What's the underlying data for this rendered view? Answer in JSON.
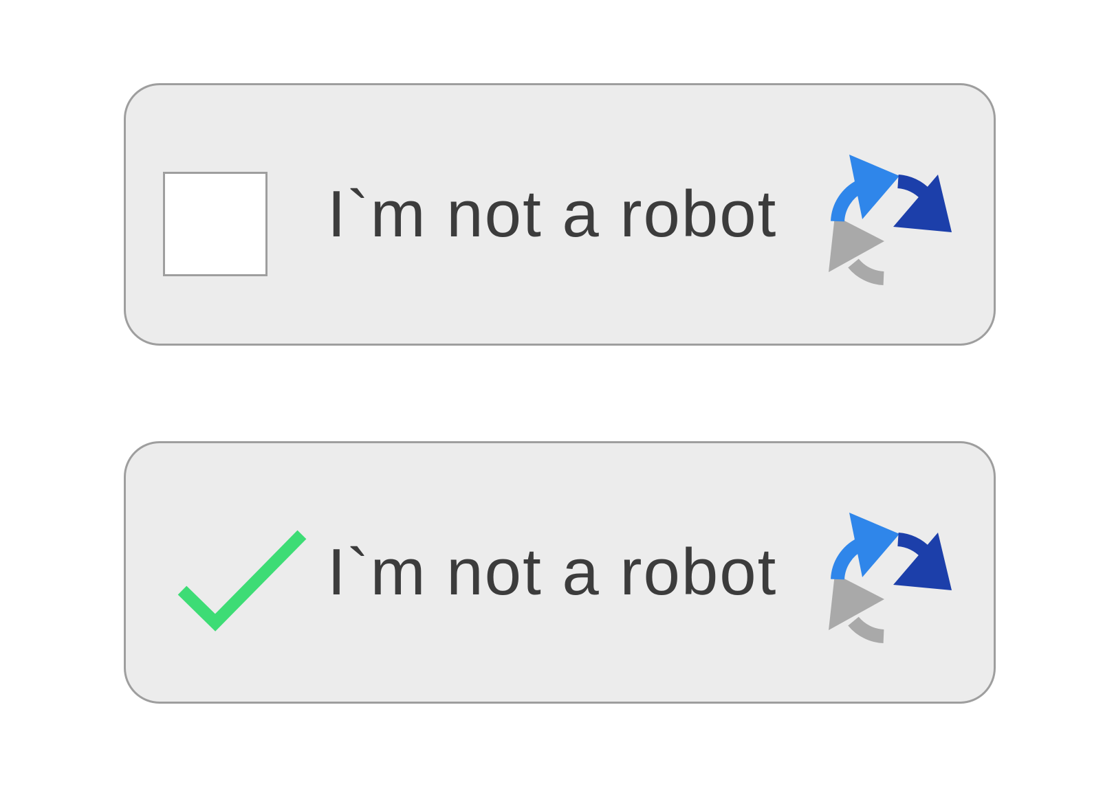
{
  "captchas": [
    {
      "state": "unchecked",
      "label": "I`m not a robot"
    },
    {
      "state": "checked",
      "label": "I`m not a robot"
    }
  ],
  "colors": {
    "box_background": "#ececec",
    "box_border": "#9e9e9e",
    "text": "#3c3c3c",
    "checkmark": "#3ddc75",
    "logo_light_blue": "#2f86ea",
    "logo_dark_blue": "#1c3faa",
    "logo_gray": "#a9a9a9"
  },
  "icons": {
    "checkbox": "checkbox-empty",
    "checkmark": "checkmark-icon",
    "logo": "recaptcha-logo-icon"
  }
}
